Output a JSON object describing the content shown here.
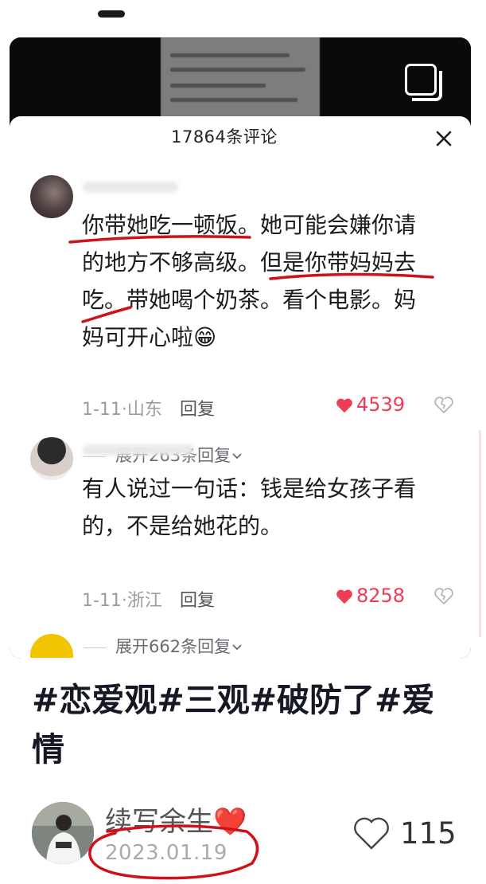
{
  "sheet": {
    "title": "17864条评论"
  },
  "comments": [
    {
      "text": "你带她吃一顿饭。她可能会嫌你请的地方不够高级。但是你带妈妈去吃。带她喝个奶茶。看个电影。妈妈可开心啦😁",
      "lines": [
        "你带她吃一顿饭。她可能会嫌你请",
        "的地方不够高级。但是你带妈妈去",
        "吃。带她喝个奶茶。看个电影。妈",
        "妈可开心啦😁"
      ],
      "date_region": "1-11·山东",
      "reply_label": "回复",
      "likes": "4539",
      "expand": "展开263条回复"
    },
    {
      "text": "有人说过一句话：钱是给女孩子看的，不是给她花的。",
      "lines": [
        "有人说过一句话：钱是给女孩子看",
        "的，不是给她花的。"
      ],
      "date_region": "1-11·浙江",
      "reply_label": "回复",
      "likes": "8258",
      "expand": "展开662条回复"
    }
  ],
  "post": {
    "hashtag_lines": [
      "#恋爱观#三观#破防了#爱",
      "情"
    ],
    "author": "续写余生❤️",
    "date": "2023.01.19",
    "like_count": "115"
  },
  "icons": {
    "close": "close-icon",
    "multi_image": "multi-image-icon",
    "like": "heart-filled-icon",
    "dislike": "broken-heart-icon",
    "chevron": "chevron-down-icon",
    "like_outline": "heart-outline-icon"
  },
  "colors": {
    "like": "#ef3b54",
    "annotation": "#d0101b"
  }
}
